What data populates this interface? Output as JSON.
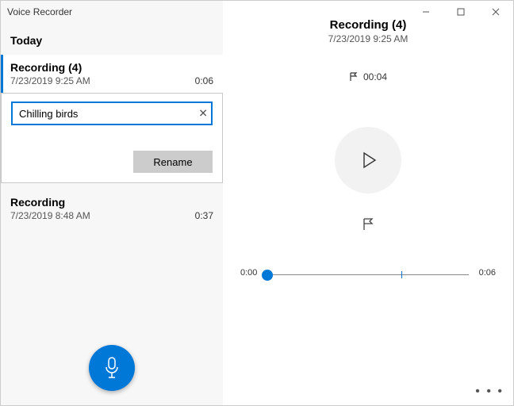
{
  "app_title": "Voice Recorder",
  "section_label": "Today",
  "recordings": [
    {
      "name": "Recording (4)",
      "date": "7/23/2019 9:25 AM",
      "duration": "0:06",
      "selected": true
    },
    {
      "name": "Recording",
      "date": "7/23/2019 8:48 AM",
      "duration": "0:37",
      "selected": false
    }
  ],
  "rename": {
    "input_value": "Chilling birds",
    "button_label": "Rename"
  },
  "player": {
    "title": "Recording (4)",
    "date": "7/23/2019 9:25 AM",
    "marker_time": "00:04",
    "position_label": "0:00",
    "duration_label": "0:06",
    "marker_fraction": 0.667
  },
  "accent_color": "#0078d7"
}
